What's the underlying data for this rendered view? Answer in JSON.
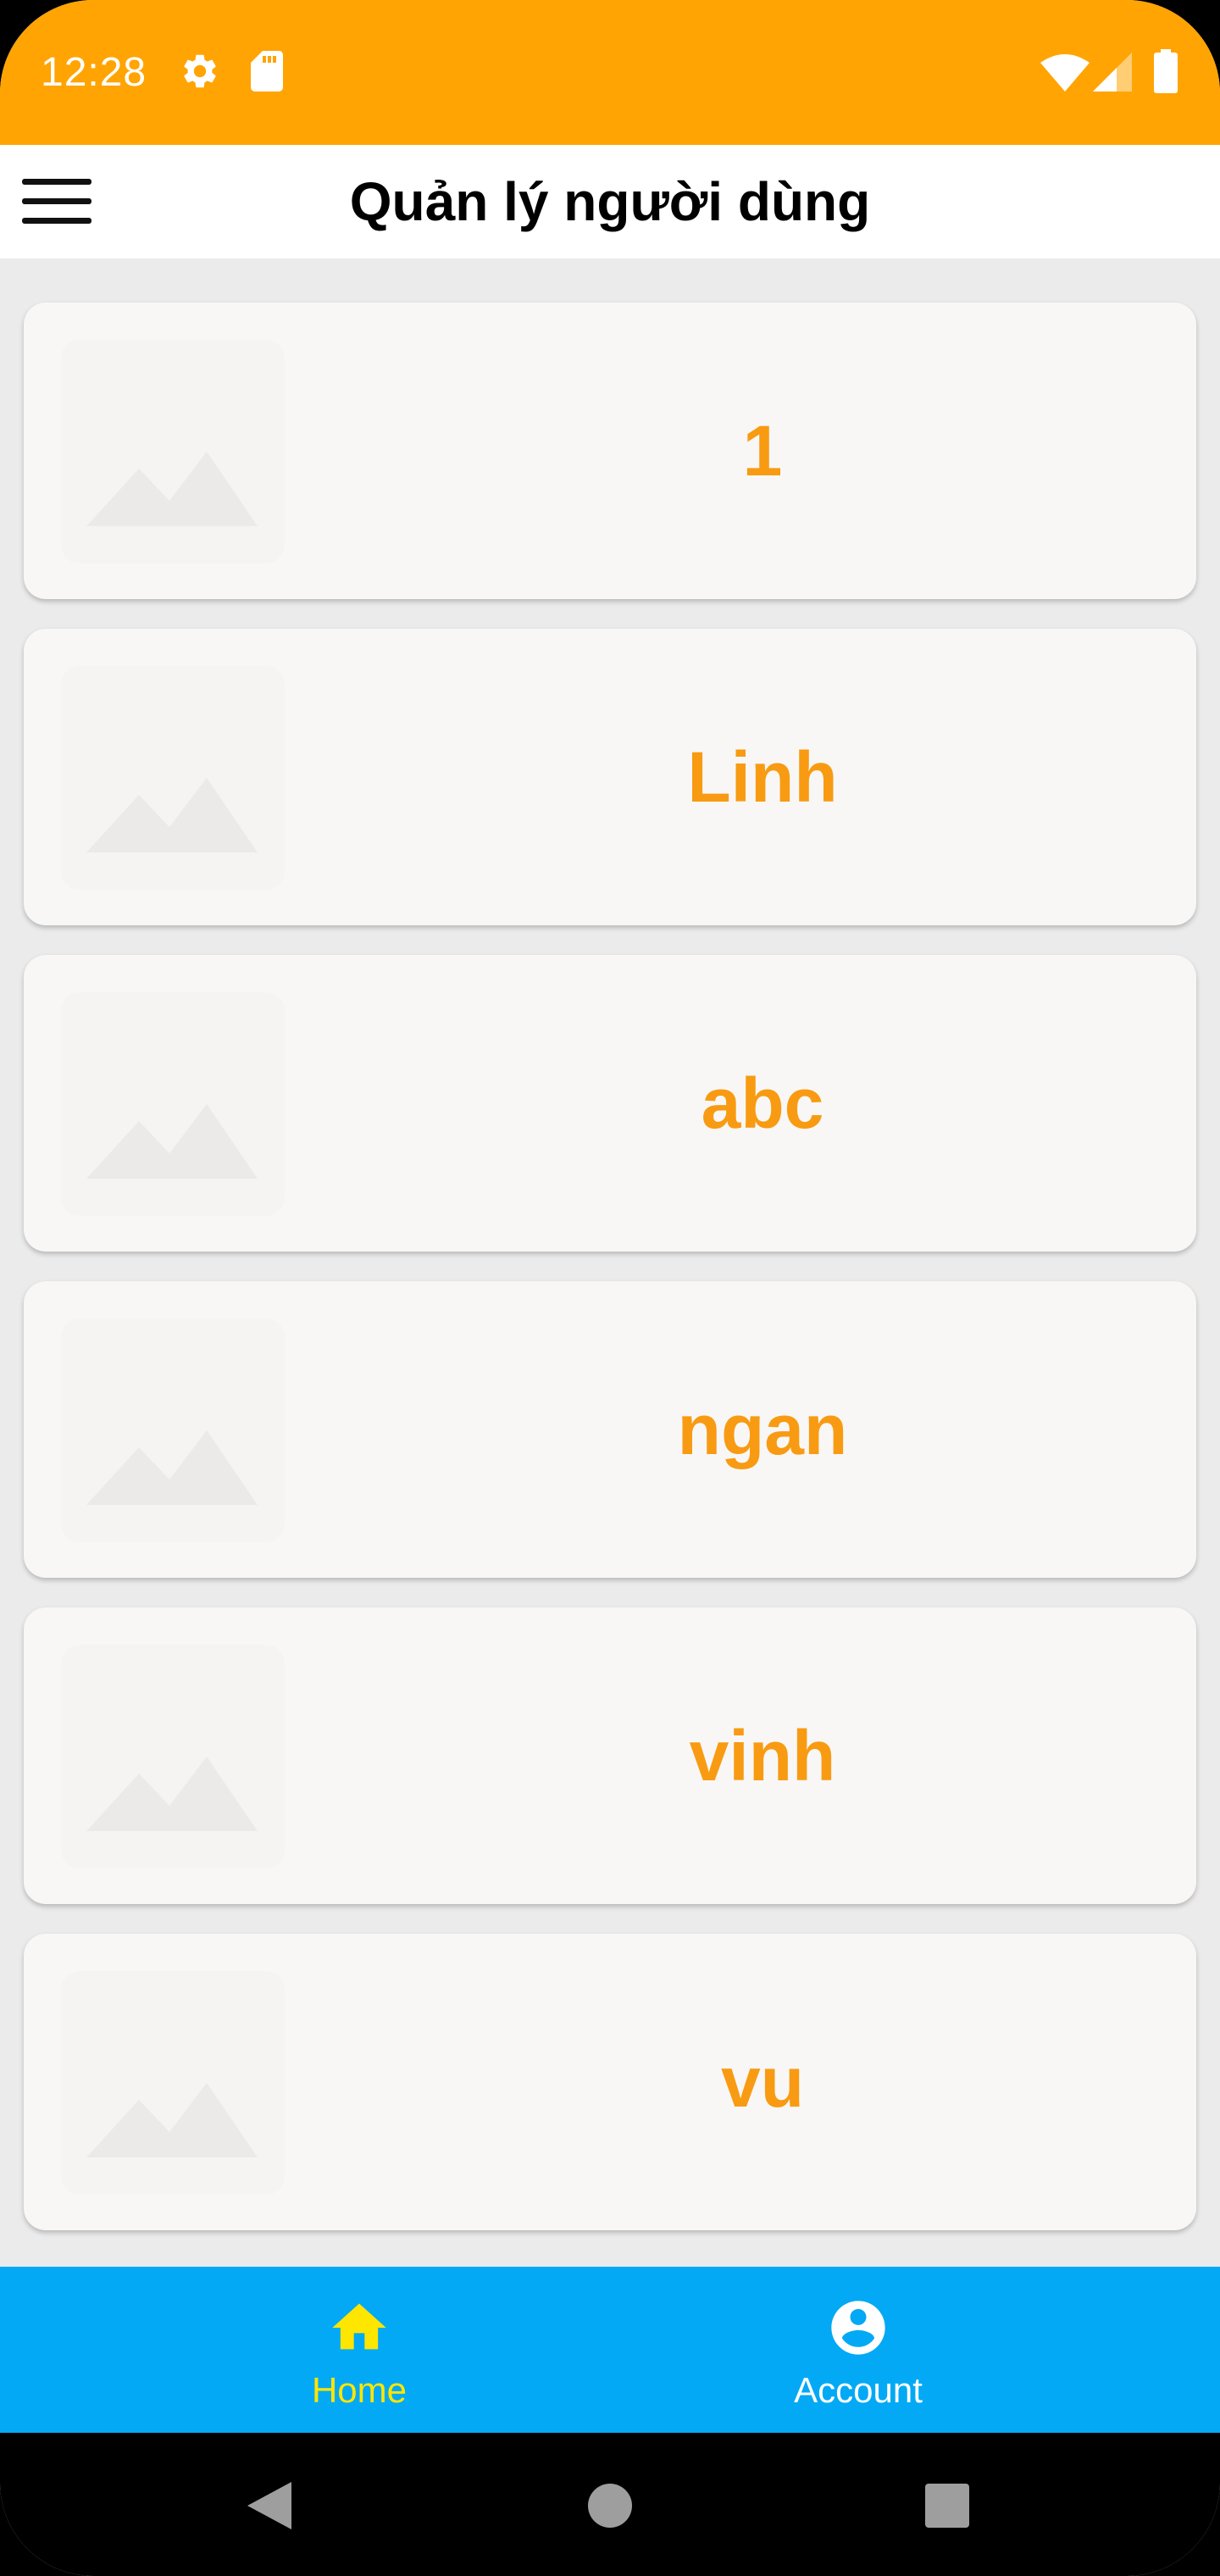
{
  "status_bar": {
    "time": "12:28",
    "background": "#ffa402",
    "icons": [
      "gear-icon",
      "sd-card-icon",
      "wifi-icon",
      "signal-icon",
      "battery-icon"
    ]
  },
  "app_bar": {
    "title": "Quản lý người dùng",
    "menu_icon": "hamburger-menu-icon"
  },
  "users": [
    {
      "name": "1",
      "avatar_icon": "image-placeholder-icon"
    },
    {
      "name": "Linh",
      "avatar_icon": "image-placeholder-icon"
    },
    {
      "name": "abc",
      "avatar_icon": "image-placeholder-icon"
    },
    {
      "name": "ngan",
      "avatar_icon": "image-placeholder-icon"
    },
    {
      "name": "vinh",
      "avatar_icon": "image-placeholder-icon"
    },
    {
      "name": "vu",
      "avatar_icon": "image-placeholder-icon"
    }
  ],
  "bottom_nav": {
    "background": "#03a9f4",
    "items": [
      {
        "label": "Home",
        "icon": "home-icon",
        "active": true,
        "color": "#ffe600"
      },
      {
        "label": "Account",
        "icon": "account-circle-icon",
        "active": false,
        "color": "#ffffff"
      }
    ]
  },
  "system_nav": {
    "buttons": [
      "back-icon",
      "home-circle-icon",
      "recents-square-icon"
    ]
  },
  "colors": {
    "accent": "#f89b12",
    "card_background": "#f8f7f6",
    "list_background": "#ebebeb"
  }
}
